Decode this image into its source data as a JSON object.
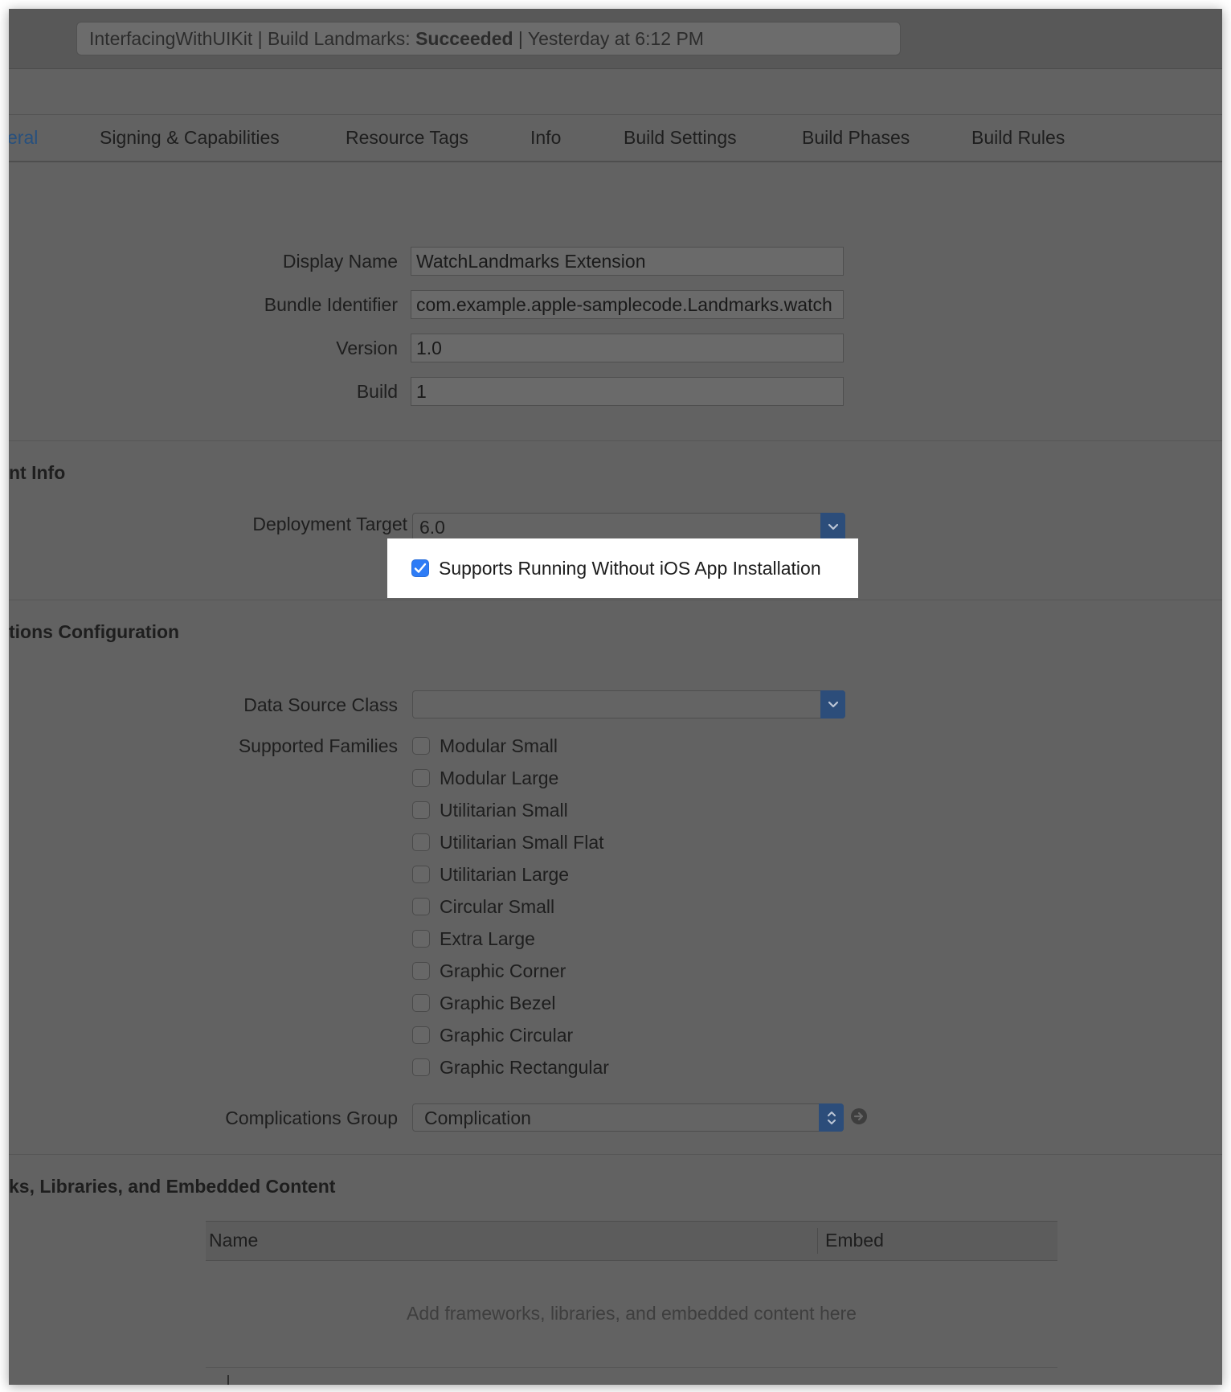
{
  "activity": {
    "prefix": "InterfacingWithUIKit | Build Landmarks: ",
    "status": "Succeeded",
    "suffix": " | Yesterday at 6:12 PM"
  },
  "tabs": [
    {
      "label": "eral",
      "active": true
    },
    {
      "label": "Signing & Capabilities"
    },
    {
      "label": "Resource Tags"
    },
    {
      "label": "Info"
    },
    {
      "label": "Build Settings"
    },
    {
      "label": "Build Phases"
    },
    {
      "label": "Build Rules"
    }
  ],
  "identity": {
    "display_name": {
      "label": "Display Name",
      "value": "WatchLandmarks Extension"
    },
    "bundle_identifier": {
      "label": "Bundle Identifier",
      "value": "com.example.apple-samplecode.Landmarks.watch"
    },
    "version": {
      "label": "Version",
      "value": "1.0"
    },
    "build": {
      "label": "Build",
      "value": "1"
    }
  },
  "deployment": {
    "title": "nt Info",
    "target_label": "Deployment Target",
    "target_value": "6.0",
    "supports_running_label": "Supports Running Without iOS App Installation",
    "supports_running_checked": true
  },
  "complications": {
    "title": "tions Configuration",
    "data_source_label": "Data Source Class",
    "data_source_value": "",
    "families_label": "Supported Families",
    "families": [
      {
        "label": "Modular Small",
        "checked": false
      },
      {
        "label": "Modular Large",
        "checked": false
      },
      {
        "label": "Utilitarian Small",
        "checked": false
      },
      {
        "label": "Utilitarian Small Flat",
        "checked": false
      },
      {
        "label": "Utilitarian Large",
        "checked": false
      },
      {
        "label": "Circular Small",
        "checked": false
      },
      {
        "label": "Extra Large",
        "checked": false
      },
      {
        "label": "Graphic Corner",
        "checked": false
      },
      {
        "label": "Graphic Bezel",
        "checked": false
      },
      {
        "label": "Graphic Circular",
        "checked": false
      },
      {
        "label": "Graphic Rectangular",
        "checked": false
      }
    ],
    "group_label": "Complications Group",
    "group_value": "Complication"
  },
  "frameworks": {
    "title": "ks, Libraries, and Embedded Content",
    "columns": [
      "Name",
      "Embed"
    ],
    "placeholder": "Add frameworks, libraries, and embedded content here"
  },
  "colors": {
    "window_bg": "#626262",
    "accent_blue": "#2c4d7a",
    "checkbox_checked": "#2e7cf6",
    "highlight_bg": "#ffffff"
  }
}
